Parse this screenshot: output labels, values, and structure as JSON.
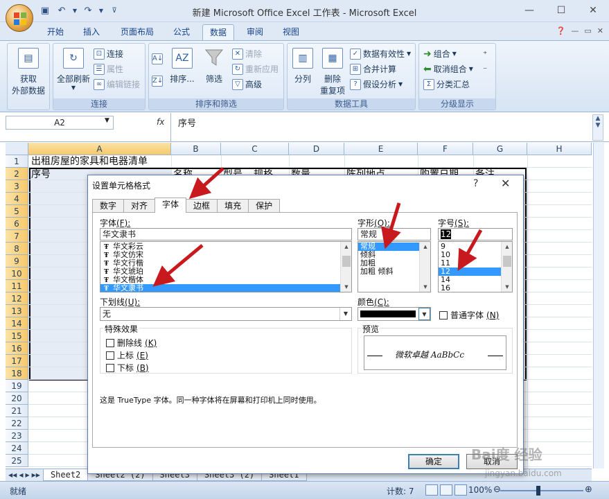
{
  "window": {
    "title": "新建 Microsoft Office Excel 工作表 - Microsoft Excel",
    "qat": [
      "save-icon",
      "undo-icon",
      "redo-icon",
      "customize-icon"
    ],
    "controls": [
      "—",
      "☐",
      "✕"
    ]
  },
  "ribbon_tabs": [
    "开始",
    "插入",
    "页面布局",
    "公式",
    "数据",
    "审阅",
    "视图"
  ],
  "active_tab": "数据",
  "ribbon": {
    "get_external": {
      "label1": "获取",
      "label2": "外部数据"
    },
    "connections": {
      "refresh1": "全部刷新",
      "items": [
        "连接",
        "属性",
        "编辑链接"
      ],
      "group": "连接"
    },
    "sort_filter": {
      "sort": "排序...",
      "filter": "筛选",
      "items": [
        "清除",
        "重新应用",
        "高级"
      ],
      "group": "排序和筛选"
    },
    "data_tools": {
      "split": "分列",
      "remove1": "删除",
      "remove2": "重复项",
      "items": [
        "数据有效性",
        "合并计算",
        "假设分析"
      ],
      "group": "数据工具"
    },
    "outline": {
      "items": [
        "组合",
        "取消组合",
        "分类汇总"
      ],
      "group": "分级显示"
    }
  },
  "formula_bar": {
    "name_box": "A2",
    "fx": "fx",
    "content": "序号"
  },
  "sheet": {
    "columns": [
      "A",
      "B",
      "C",
      "D",
      "E",
      "F",
      "G",
      "H"
    ],
    "rows": [
      "1",
      "2",
      "3",
      "4",
      "5",
      "6",
      "7",
      "8",
      "9",
      "10",
      "11",
      "12",
      "13",
      "14",
      "15",
      "16",
      "17",
      "18",
      "19",
      "20",
      "21",
      "22",
      "23",
      "24",
      "25"
    ],
    "a1": "出租房屋的家具和电器清单",
    "a2": "序号",
    "row2_headers": [
      "名称",
      "型号",
      "规格",
      "数量",
      "陈列地点",
      "购置日期",
      "备注"
    ]
  },
  "sheet_tabs": [
    "Sheet2",
    "Sheet2 (2)",
    "Sheet3",
    "Sheet3 (2)",
    "Sheet1"
  ],
  "status": {
    "ready": "就绪",
    "count": "计数: 7",
    "zoom": "100%"
  },
  "dialog": {
    "title": "设置单元格格式",
    "help": "?",
    "close": "✕",
    "tabs": [
      "数字",
      "对齐",
      "字体",
      "边框",
      "填充",
      "保护"
    ],
    "active_tab": "字体",
    "font_label": "字体",
    "font_key": "(F):",
    "font_value": "华文隶书",
    "font_list": [
      "华文彩云",
      "华文仿宋",
      "华文行楷",
      "华文琥珀",
      "华文楷体",
      "华文隶书"
    ],
    "font_selected": "华文隶书",
    "style_label": "字形",
    "style_key": "(O):",
    "style_value": "常规",
    "style_list": [
      "常规",
      "倾斜",
      "加粗",
      "加粗 倾斜"
    ],
    "style_selected": "常规",
    "size_label": "字号",
    "size_key": "(S):",
    "size_value": "12",
    "size_list": [
      "9",
      "10",
      "11",
      "12",
      "14",
      "16"
    ],
    "size_selected": "12",
    "underline_label": "下划线",
    "underline_key": "(U):",
    "underline_value": "无",
    "color_label": "颜色",
    "color_key": "(C):",
    "color_value": "#000000",
    "normal_font": "普通字体",
    "normal_font_key": "(N)",
    "effects_label": "特殊效果",
    "effects": [
      {
        "label": "删除线",
        "key": "(K)"
      },
      {
        "label": "上标",
        "key": "(E)"
      },
      {
        "label": "下标",
        "key": "(B)"
      }
    ],
    "preview_label": "预览",
    "preview_text": "微软卓越 AaBbCc",
    "info": "这是 TrueType 字体。同一种字体将在屏幕和打印机上同时使用。",
    "ok": "确定",
    "cancel": "取消"
  },
  "watermark": {
    "line1": "Bai度 经验",
    "line2": "jingyan.baidu.com"
  }
}
